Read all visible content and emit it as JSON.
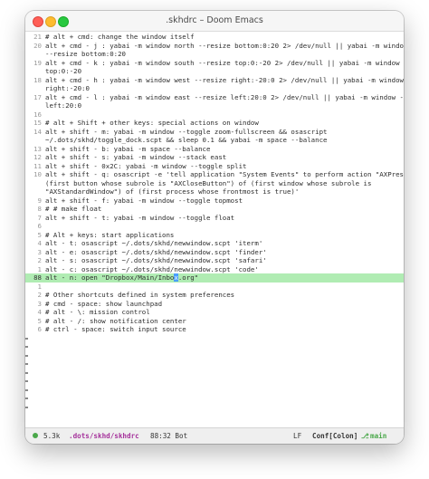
{
  "window": {
    "title": ".skhdrc – Doom Emacs"
  },
  "editor": {
    "lines": [
      {
        "num": "21",
        "text": "# alt + cmd: change the window itself"
      },
      {
        "num": "20",
        "text": "alt + cmd - j : yabai -m window north --resize bottom:0:20 2> /dev/null || yabai -m window"
      },
      {
        "num": "",
        "text": "--resize bottom:0:20"
      },
      {
        "num": "19",
        "text": "alt + cmd - k : yabai -m window south --resize top:0:-20 2> /dev/null || yabai -m window --resize"
      },
      {
        "num": "",
        "text": "top:0:-20"
      },
      {
        "num": "18",
        "text": "alt + cmd - h : yabai -m window west --resize right:-20:0 2> /dev/null || yabai -m window --resize"
      },
      {
        "num": "",
        "text": "right:-20:0"
      },
      {
        "num": "17",
        "text": "alt + cmd - l : yabai -m window east --resize left:20:0 2> /dev/null || yabai -m window --resize"
      },
      {
        "num": "",
        "text": "left:20:0"
      },
      {
        "num": "16",
        "text": ""
      },
      {
        "num": "15",
        "text": "# alt + Shift + other keys: special actions on window"
      },
      {
        "num": "14",
        "text": "alt + shift - m: yabai -m window --toggle zoom-fullscreen && osascript"
      },
      {
        "num": "",
        "text": "~/.dots/skhd/toggle_dock.scpt && sleep 0.1 && yabai -m space --balance"
      },
      {
        "num": "13",
        "text": "alt + shift - b: yabai -m space --balance"
      },
      {
        "num": "12",
        "text": "alt + shift - s: yabai -m window --stack east"
      },
      {
        "num": "11",
        "text": "alt + shift - 0x2C: yabai -m window --toggle split"
      },
      {
        "num": "10",
        "text": "alt + shift - q: osascript -e 'tell application \"System Events\" to perform action \"AXPress\" of"
      },
      {
        "num": "",
        "text": "(first button whose subrole is \"AXCloseButton\") of (first window whose subrole is"
      },
      {
        "num": "",
        "text": "\"AXStandardWindow\") of (first process whose frontmost is true)'"
      },
      {
        "num": "9",
        "text": "alt + shift - f: yabai -m window --toggle topmost"
      },
      {
        "num": "8",
        "text": "# # make float"
      },
      {
        "num": "7",
        "text": "alt + shift - t: yabai -m window --toggle float"
      },
      {
        "num": "6",
        "text": ""
      },
      {
        "num": "5",
        "text": "# Alt + keys: start applications"
      },
      {
        "num": "4",
        "text": "alt - t: osascript ~/.dots/skhd/newwindow.scpt 'iterm'"
      },
      {
        "num": "3",
        "text": "alt - e: osascript ~/.dots/skhd/newwindow.scpt 'finder'"
      },
      {
        "num": "2",
        "text": "alt - s: osascript ~/.dots/skhd/newwindow.scpt 'safari'"
      },
      {
        "num": "1",
        "text": "alt - c: osascript ~/.dots/skhd/newwindow.scpt 'code'"
      },
      {
        "num": "88",
        "text": "alt - n: open \"Dropbox/Main/Inbox.org\"",
        "current": true
      },
      {
        "num": "1",
        "text": ""
      },
      {
        "num": "2",
        "text": "# Other shortcuts defined in system preferences"
      },
      {
        "num": "3",
        "text": "# cmd - space: show launchpad"
      },
      {
        "num": "4",
        "text": "# alt - \\: mission control"
      },
      {
        "num": "5",
        "text": "# alt - /: show notification center"
      },
      {
        "num": "6",
        "text": "# ctrl - space: switch input source"
      }
    ]
  },
  "modeline": {
    "size": "5.3k",
    "path": ".dots/skhd/skhdrc",
    "position": "88:32 Bot",
    "eol": "LF",
    "mode": "Conf[Colon]",
    "vc_icon": "branch-icon",
    "vc": "main",
    "colors": {
      "path": "#a5329b",
      "vc": "#4aa84a",
      "current_line": "#b0ecb3"
    }
  }
}
